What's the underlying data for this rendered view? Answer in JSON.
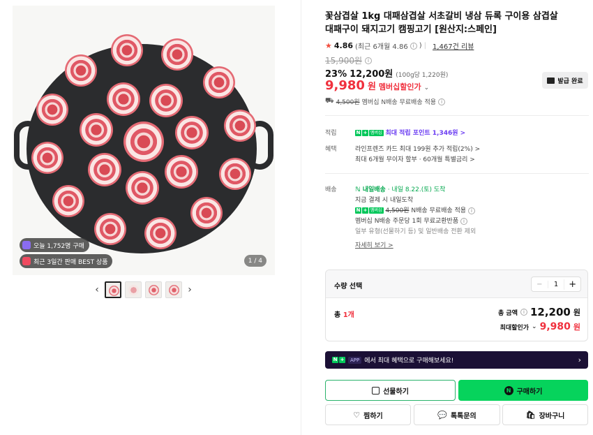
{
  "product": {
    "title": "꽃삼겹살 1kg 대패삼겹살 서초갈비 냉삼 듀록 구이용 삼겹살 대패구이 돼지고기 캠핑고기 [원산지:스페인]",
    "rating": "4.86",
    "rating_recent": "(최근 6개월 4.86",
    "review_count": "1,467건 리뷰",
    "original_price": "15,900원",
    "discount_rate": "23%",
    "price": "12,200원",
    "unit_price": "(100g당 1,220원)",
    "member_price": "9,980",
    "member_price_won": "원",
    "member_label": "멤버십할인가",
    "coupon_label": "발급 완료",
    "shipping_note_strike": "4,500원",
    "shipping_note": "멤버십 N배송 무료배송 적용"
  },
  "gallery": {
    "badge_today": "오늘 1,752명 구매",
    "badge_best": "최근 3일간 판매 BEST 상품",
    "counter": "1 / 4",
    "thumb_count": 4
  },
  "details": {
    "points_key": "적립",
    "points_value": "최대 적립 포인트 1,346원 >",
    "benefit_key": "혜택",
    "benefit_line1": "라인프렌즈 카드 최대 199원 추가 적립(2%) >",
    "benefit_line2": "최대 6개월 무이자 할부 · 60개월 특별금리 >",
    "delivery_key": "배송",
    "delivery_badge": "내일배송",
    "delivery_date": "· 내일 8.22.(토) 도착",
    "delivery_line2": "지금 결제 시 내일도착",
    "delivery_line3_strike": "4,500원",
    "delivery_line3": "N배송 무료배송 적용",
    "delivery_line4": "멤버십 N배송 주문당 1회 무료교환반품",
    "delivery_line5": "일부 유형(선물하기 등) 및 일반배송 전환 제외",
    "more_link": "자세히 보기 >"
  },
  "quantity": {
    "title": "수량 선택",
    "value": "1",
    "count_label": "총",
    "count_value": "1개",
    "total_label": "총 금액",
    "total_value": "12,200",
    "total_won": "원",
    "max_discount_label": "최대할인가",
    "max_discount_value": "9,980",
    "max_discount_won": "원"
  },
  "banner": {
    "tag": "APP",
    "text": "에서 최대 혜택으로 구매해보세요!"
  },
  "buttons": {
    "gift": "선물하기",
    "buy": "구매하기",
    "wish": "찜하기",
    "talk": "톡톡문의",
    "cart": "장바구니"
  },
  "colors": {
    "sale_red": "#f0303d",
    "naver_green": "#06d35c",
    "purple": "#6b3df2"
  }
}
